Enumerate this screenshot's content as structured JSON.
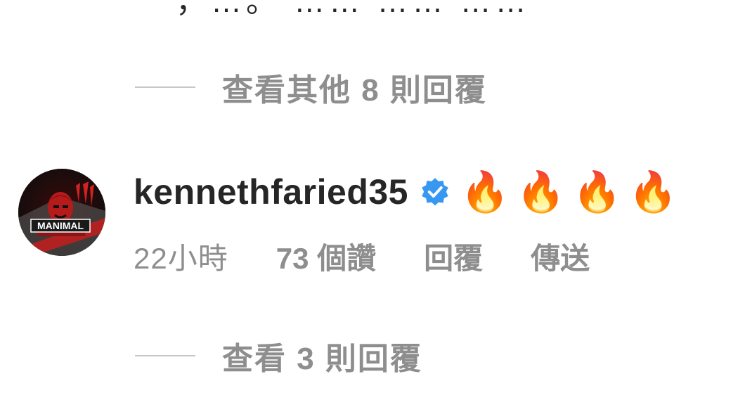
{
  "top_partial_text": "，…。 …… …… ……",
  "view_replies_1": "查看其他 8 則回覆",
  "comment": {
    "username": "kennethfaried35",
    "verified": true,
    "text": "🔥🔥🔥🔥",
    "avatar_text": "MANIMAL",
    "time": "22小時",
    "likes": "73 個讚",
    "reply_label": "回覆",
    "send_label": "傳送"
  },
  "view_replies_2": "查看 3 則回覆",
  "colors": {
    "primary_text": "#262626",
    "secondary_text": "#8e8e8e",
    "divider": "#c7c7c7",
    "verified_blue": "#3897f0"
  }
}
